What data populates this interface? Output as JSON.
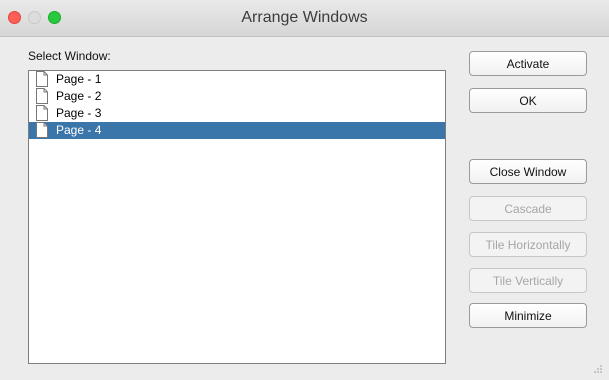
{
  "window": {
    "title": "Arrange Windows"
  },
  "select_label": "Select Window:",
  "windows_list": [
    {
      "label": "Page - 1",
      "selected": false
    },
    {
      "label": "Page - 2",
      "selected": false
    },
    {
      "label": "Page - 3",
      "selected": false
    },
    {
      "label": "Page - 4",
      "selected": true
    }
  ],
  "buttons": {
    "activate": "Activate",
    "ok": "OK",
    "close_window": "Close Window",
    "cascade": "Cascade",
    "tile_horizontally": "Tile Horizontally",
    "tile_vertically": "Tile Vertically",
    "minimize": "Minimize"
  },
  "colors": {
    "selection": "#3a76aa",
    "close_light": "#fe5f57",
    "max_light": "#27c93f"
  }
}
